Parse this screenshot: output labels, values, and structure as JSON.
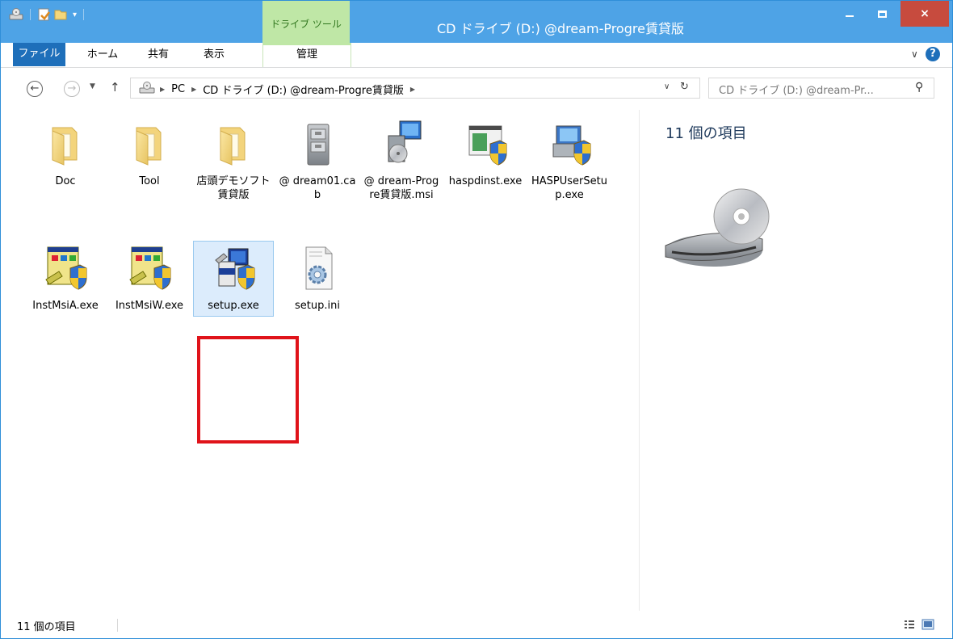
{
  "window": {
    "title": "CD ドライブ (D:) @dream-Progre賃貸版",
    "contextual_tab_group": "ドライブ ツール"
  },
  "controls": {
    "minimize": "–",
    "close": "×"
  },
  "ribbon": {
    "tabs": [
      {
        "label": "ファイル"
      },
      {
        "label": "ホーム"
      },
      {
        "label": "共有"
      },
      {
        "label": "表示"
      },
      {
        "label": "管理"
      }
    ]
  },
  "navigation": {
    "breadcrumb": [
      "PC",
      "CD ドライブ (D:) @dream-Progre賃貸版"
    ],
    "search_placeholder": "CD ドライブ (D:) @dream-Pr..."
  },
  "files": [
    {
      "name": "Doc",
      "type": "folder"
    },
    {
      "name": "Tool",
      "type": "folder"
    },
    {
      "name": "店頭デモソフト賃貸版",
      "type": "folder"
    },
    {
      "name": "@ dream01.cab",
      "type": "cab"
    },
    {
      "name": "@ dream-Progre賃貸版.msi",
      "type": "msi"
    },
    {
      "name": "haspdinst.exe",
      "type": "installer"
    },
    {
      "name": "HASPUserSetup.exe",
      "type": "setup"
    },
    {
      "name": "InstMsiA.exe",
      "type": "instmsi"
    },
    {
      "name": "InstMsiW.exe",
      "type": "instmsi"
    },
    {
      "name": "setup.exe",
      "type": "setup-exe",
      "selected": true
    },
    {
      "name": "setup.ini",
      "type": "ini"
    }
  ],
  "details": {
    "item_count": "11 個の項目"
  },
  "status": {
    "item_count": "11 個の項目"
  },
  "colors": {
    "titlebar": "#4ea3e6",
    "file_tab": "#1e6fba",
    "context_tab": "#bfe7a6",
    "close_button": "#c74b3e",
    "selection": "#dcecfc",
    "highlight_box": "#e0131a"
  }
}
